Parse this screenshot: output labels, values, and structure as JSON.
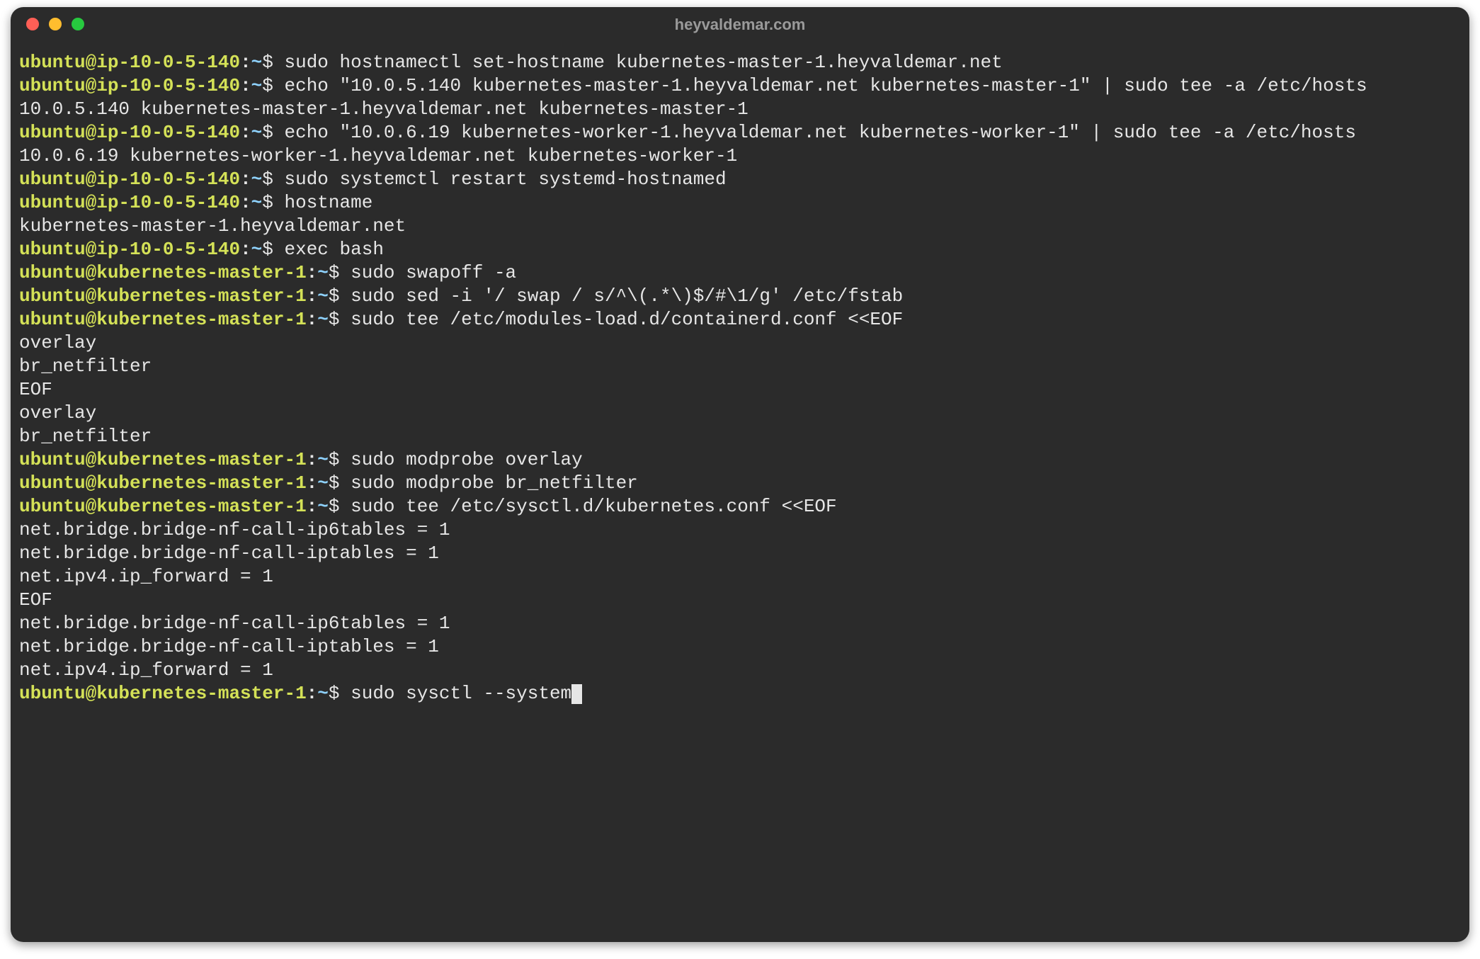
{
  "window": {
    "title": "heyvaldemar.com"
  },
  "prompts": {
    "ip": "ubuntu@ip-10-0-5-140",
    "km": "ubuntu@kubernetes-master-1",
    "sep": ":",
    "path": "~",
    "dollar": "$"
  },
  "lines": [
    {
      "type": "cmd",
      "prompt": "ip",
      "text": "sudo hostnamectl set-hostname kubernetes-master-1.heyvaldemar.net"
    },
    {
      "type": "cmd",
      "prompt": "ip",
      "text": "echo \"10.0.5.140 kubernetes-master-1.heyvaldemar.net kubernetes-master-1\" | sudo tee -a /etc/hosts"
    },
    {
      "type": "out",
      "text": "10.0.5.140 kubernetes-master-1.heyvaldemar.net kubernetes-master-1"
    },
    {
      "type": "cmd",
      "prompt": "ip",
      "text": "echo \"10.0.6.19 kubernetes-worker-1.heyvaldemar.net kubernetes-worker-1\" | sudo tee -a /etc/hosts"
    },
    {
      "type": "out",
      "text": "10.0.6.19 kubernetes-worker-1.heyvaldemar.net kubernetes-worker-1"
    },
    {
      "type": "cmd",
      "prompt": "ip",
      "text": "sudo systemctl restart systemd-hostnamed"
    },
    {
      "type": "cmd",
      "prompt": "ip",
      "text": "hostname"
    },
    {
      "type": "out",
      "text": "kubernetes-master-1.heyvaldemar.net"
    },
    {
      "type": "cmd",
      "prompt": "ip",
      "text": "exec bash"
    },
    {
      "type": "cmd",
      "prompt": "km",
      "text": "sudo swapoff -a"
    },
    {
      "type": "cmd",
      "prompt": "km",
      "text": "sudo sed -i '/ swap / s/^\\(.*\\)$/#\\1/g' /etc/fstab"
    },
    {
      "type": "cmd",
      "prompt": "km",
      "text": "sudo tee /etc/modules-load.d/containerd.conf <<EOF"
    },
    {
      "type": "out",
      "text": "overlay"
    },
    {
      "type": "out",
      "text": "br_netfilter"
    },
    {
      "type": "out",
      "text": "EOF"
    },
    {
      "type": "out",
      "text": "overlay"
    },
    {
      "type": "out",
      "text": "br_netfilter"
    },
    {
      "type": "cmd",
      "prompt": "km",
      "text": "sudo modprobe overlay"
    },
    {
      "type": "cmd",
      "prompt": "km",
      "text": "sudo modprobe br_netfilter"
    },
    {
      "type": "cmd",
      "prompt": "km",
      "text": "sudo tee /etc/sysctl.d/kubernetes.conf <<EOF"
    },
    {
      "type": "out",
      "text": "net.bridge.bridge-nf-call-ip6tables = 1"
    },
    {
      "type": "out",
      "text": "net.bridge.bridge-nf-call-iptables = 1"
    },
    {
      "type": "out",
      "text": "net.ipv4.ip_forward = 1"
    },
    {
      "type": "out",
      "text": "EOF"
    },
    {
      "type": "out",
      "text": "net.bridge.bridge-nf-call-ip6tables = 1"
    },
    {
      "type": "out",
      "text": "net.bridge.bridge-nf-call-iptables = 1"
    },
    {
      "type": "out",
      "text": "net.ipv4.ip_forward = 1"
    },
    {
      "type": "cmd",
      "prompt": "km",
      "text": "sudo sysctl --system",
      "cursor": true
    }
  ]
}
